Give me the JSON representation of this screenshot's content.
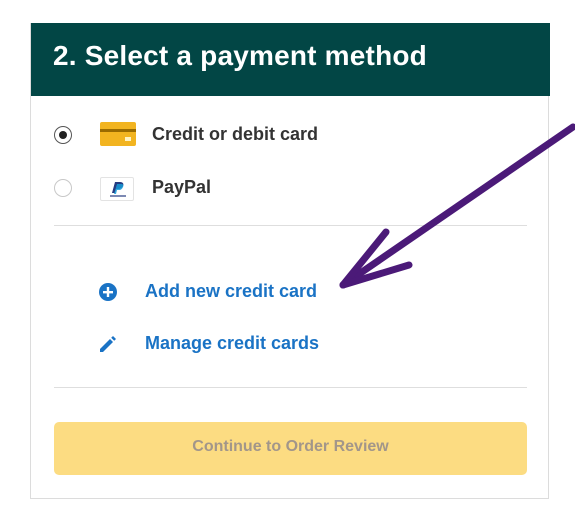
{
  "header": {
    "title": "2. Select a payment method"
  },
  "payment_options": [
    {
      "label": "Credit or debit card",
      "selected": true,
      "icon": "credit-card-icon"
    },
    {
      "label": "PayPal",
      "selected": false,
      "icon": "paypal-icon"
    }
  ],
  "links": {
    "add_card": {
      "label": "Add new credit card",
      "icon": "plus-circle-icon"
    },
    "manage_cards": {
      "label": "Manage credit cards",
      "icon": "pencil-icon"
    }
  },
  "continue_button": {
    "label": "Continue to Order Review",
    "enabled": false
  },
  "colors": {
    "header_bg": "#024645",
    "link": "#1a73c5",
    "button_bg": "#fcdc82",
    "annotation_arrow": "#4b1a78"
  }
}
